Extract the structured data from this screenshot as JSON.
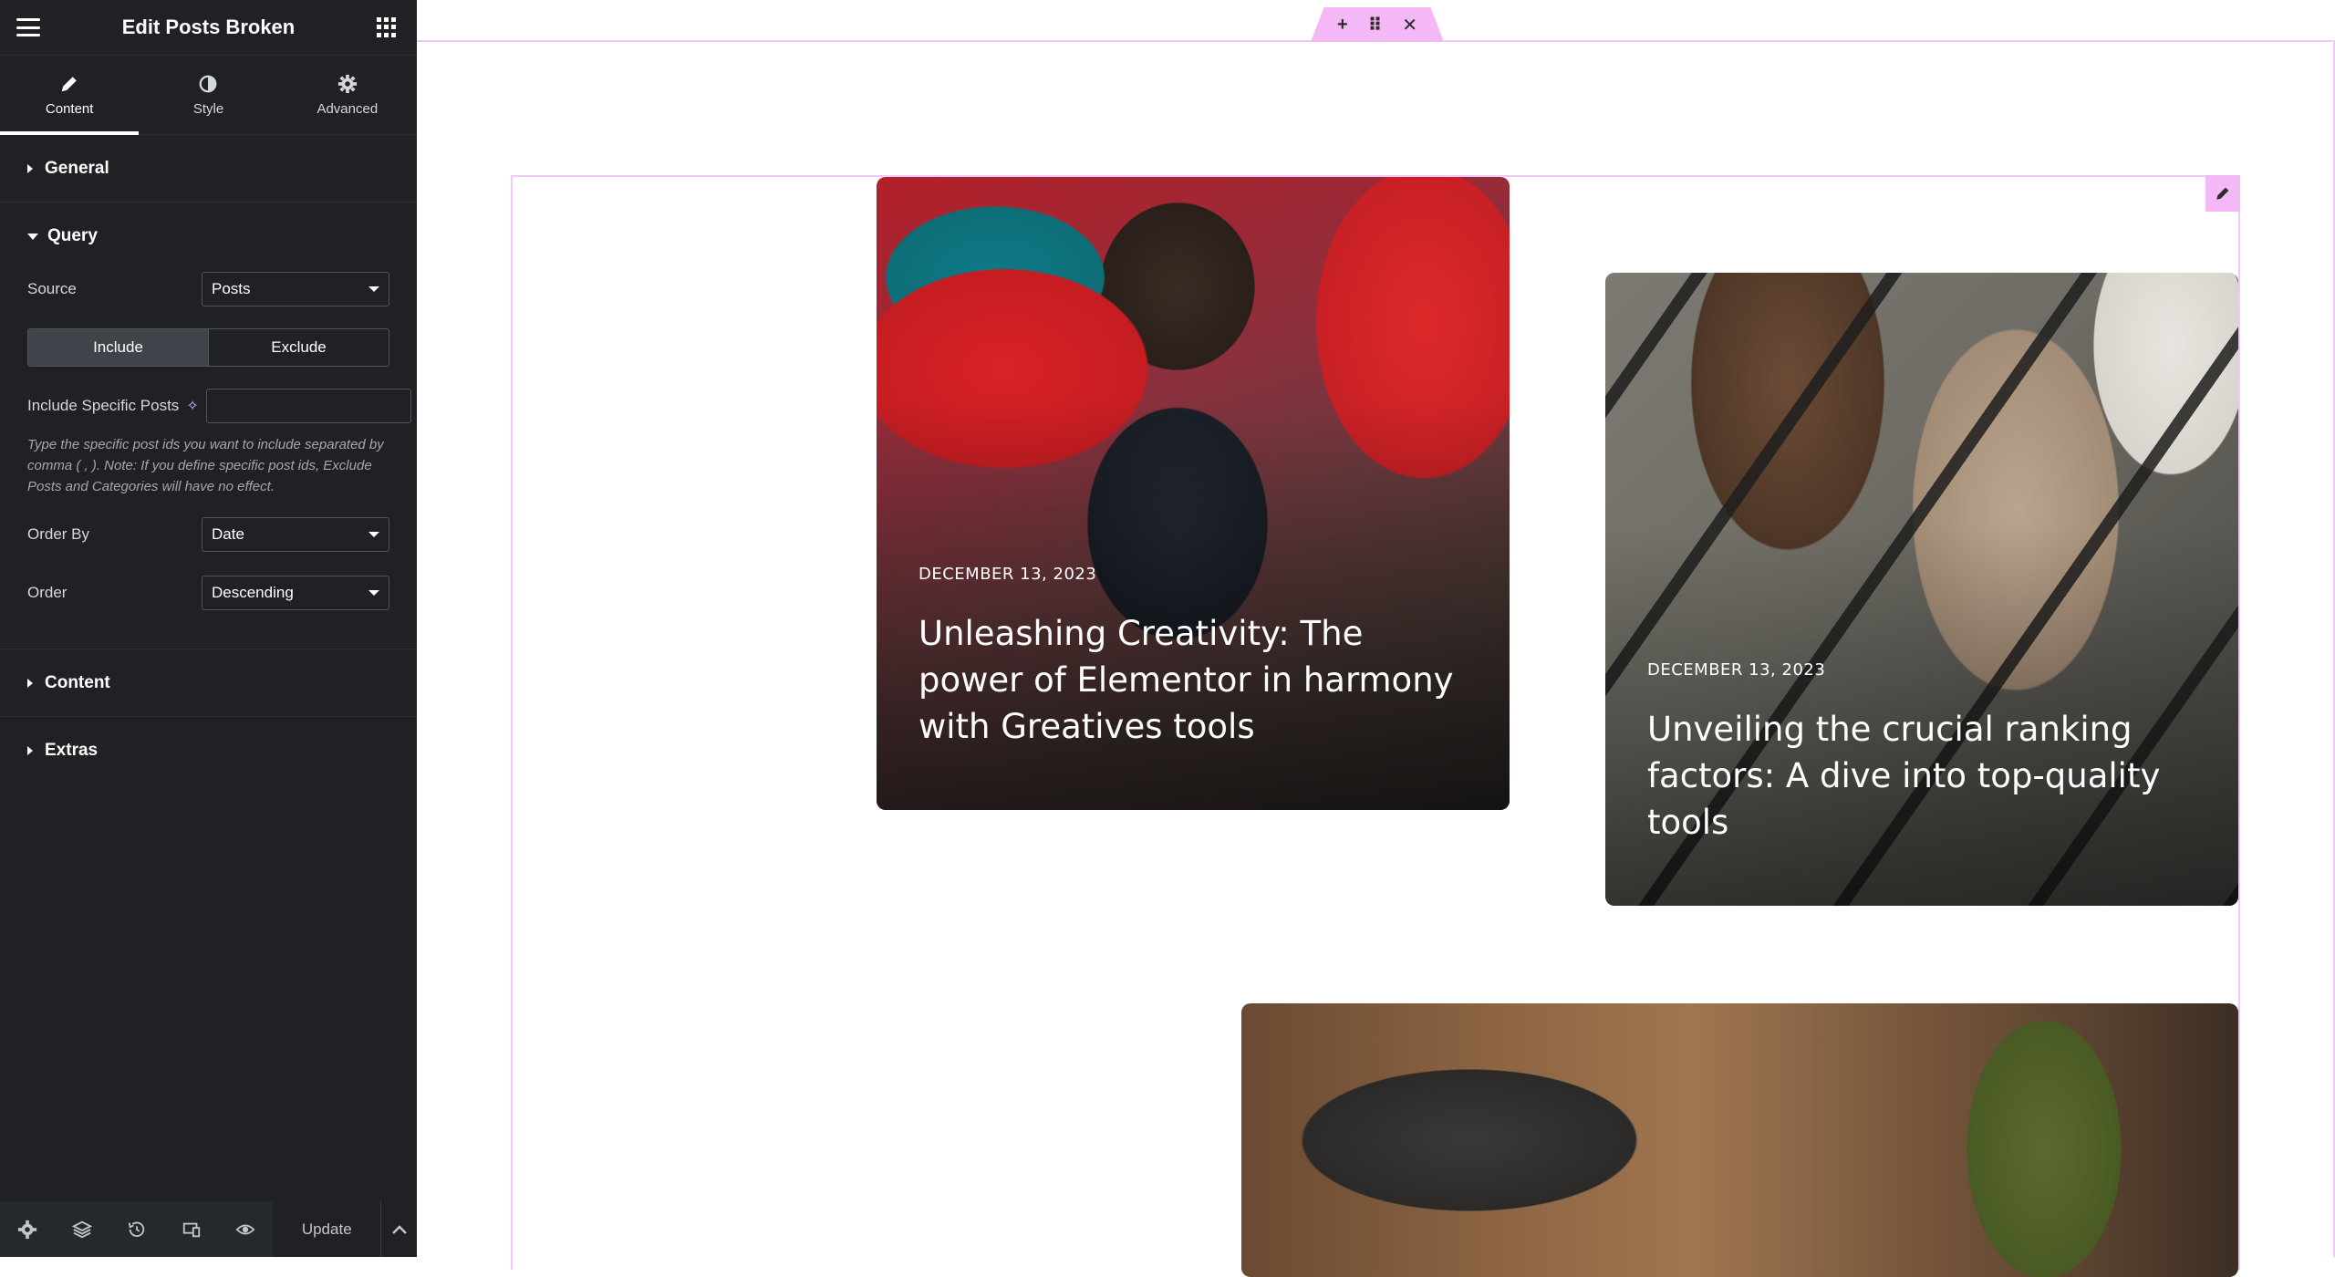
{
  "panel": {
    "title": "Edit Posts Broken",
    "tabs": [
      {
        "label": "Content",
        "icon": "pencil-icon",
        "active": true
      },
      {
        "label": "Style",
        "icon": "half-circle-icon",
        "active": false
      },
      {
        "label": "Advanced",
        "icon": "gear-icon",
        "active": false
      }
    ],
    "sections": {
      "general": "General",
      "query": "Query",
      "content": "Content",
      "extras": "Extras"
    },
    "query": {
      "source_label": "Source",
      "source_value": "Posts",
      "include_label": "Include",
      "exclude_label": "Exclude",
      "include_posts_label": "Include Specific Posts",
      "include_posts_value": "",
      "description": "Type the specific post ids you want to include separated by comma ( , ). Note: If you define specific post ids, Exclude Posts and Categories will have no effect.",
      "order_by_label": "Order By",
      "order_by_value": "Date",
      "order_label": "Order",
      "order_value": "Descending"
    },
    "footer": {
      "update_label": "Update"
    }
  },
  "preview": {
    "handle": {
      "add": "+",
      "move": "⠿",
      "close": "✕"
    },
    "posts": [
      {
        "date": "DECEMBER 13, 2023",
        "title": "Unleashing Creativity: The power of Elementor in harmony with Greatives tools"
      },
      {
        "date": "DECEMBER 13, 2023",
        "title": "Unveiling the crucial ranking factors: A dive into top-quality tools"
      }
    ]
  },
  "colors": {
    "panel_bg": "#1f2124",
    "selection_accent": "#f3b8f5",
    "selection_line": "#f0c8f6"
  }
}
